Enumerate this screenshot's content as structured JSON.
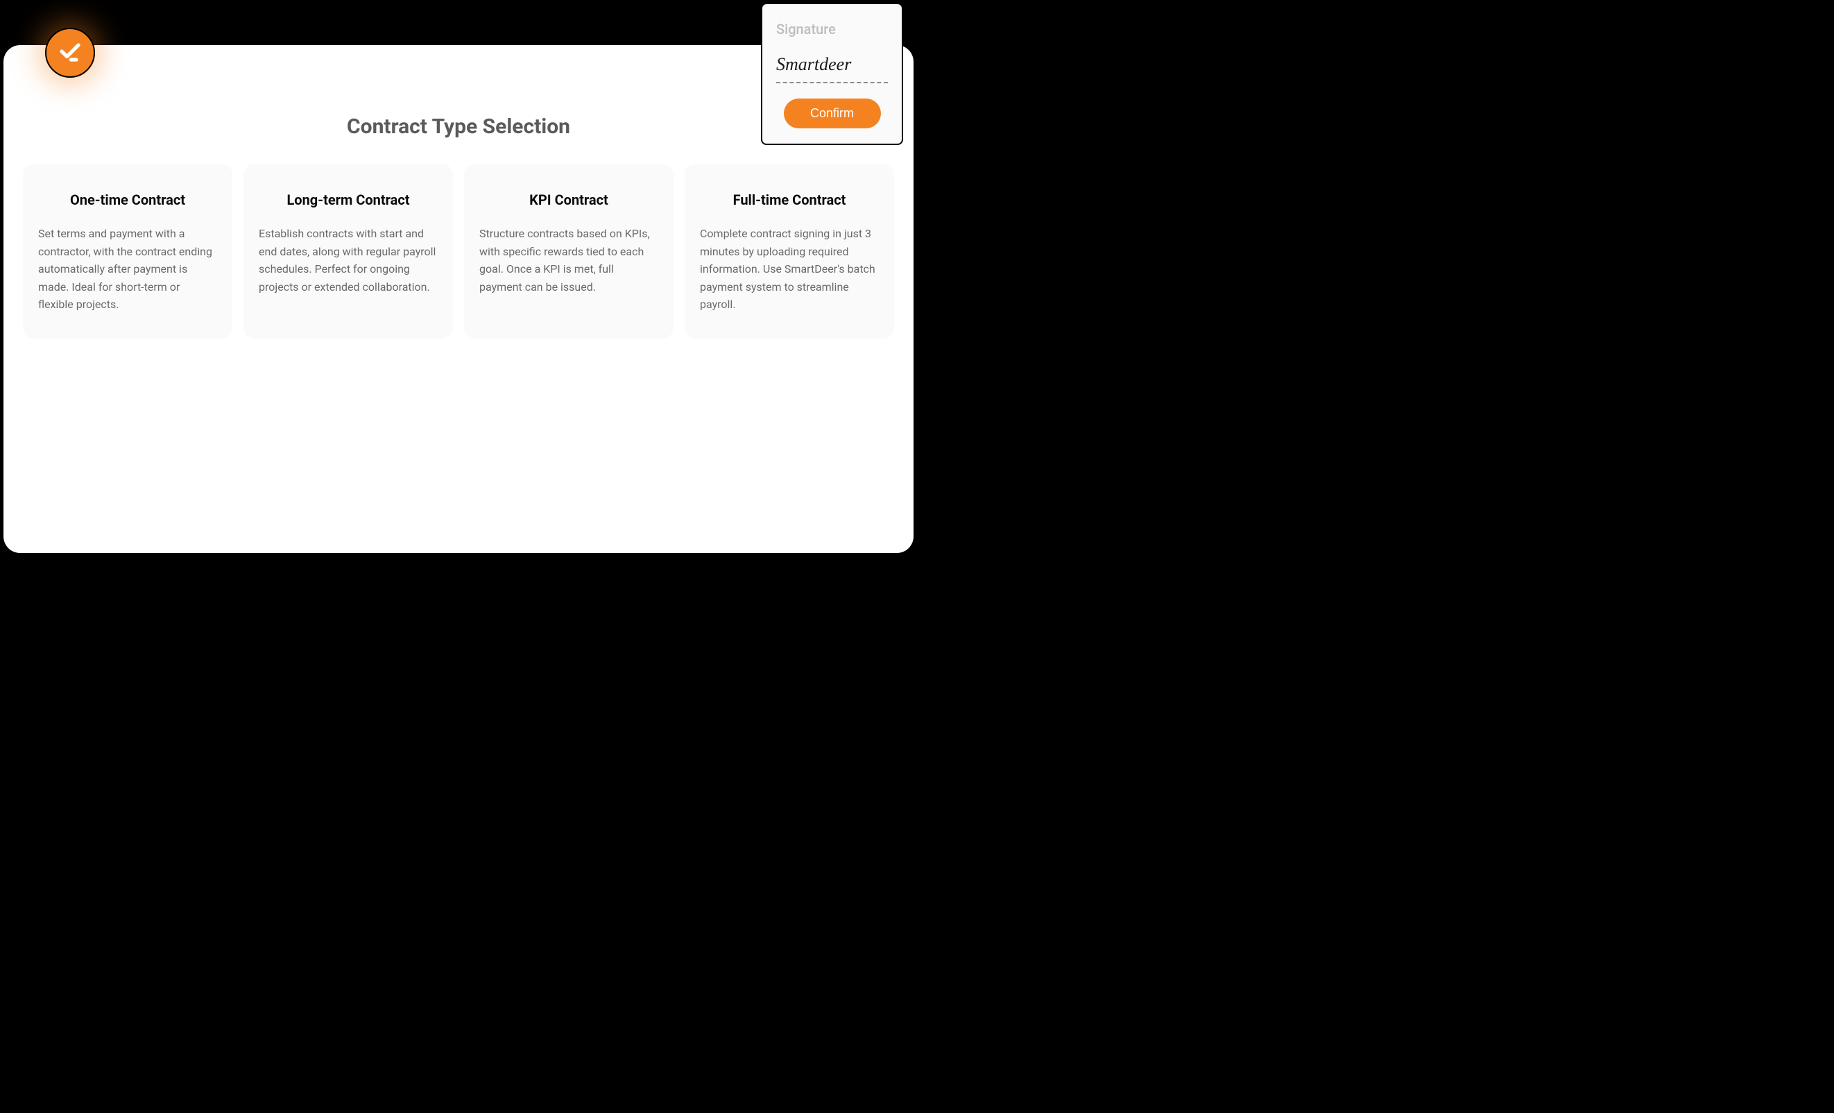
{
  "colors": {
    "accent": "#F58220"
  },
  "page": {
    "title": "Contract Type Selection"
  },
  "cards": [
    {
      "title": "One-time Contract",
      "body": "Set terms and payment with a contractor, with the contract ending automatically after payment is made. Ideal for short-term or flexible projects."
    },
    {
      "title": "Long-term Contract",
      "body": "Establish contracts with start and end dates, along with regular payroll schedules. Perfect for ongoing projects or extended collaboration."
    },
    {
      "title": "KPI Contract",
      "body": "Structure contracts based on KPIs, with specific rewards tied to each goal. Once a KPI is met, full payment can be issued."
    },
    {
      "title": "Full-time Contract",
      "body": "Complete contract signing in just 3 minutes by uploading required information. Use SmartDeer's batch payment system to streamline payroll."
    }
  ],
  "signature": {
    "label": "Signature",
    "value": "Smartdeer",
    "confirm_label": "Confirm"
  }
}
